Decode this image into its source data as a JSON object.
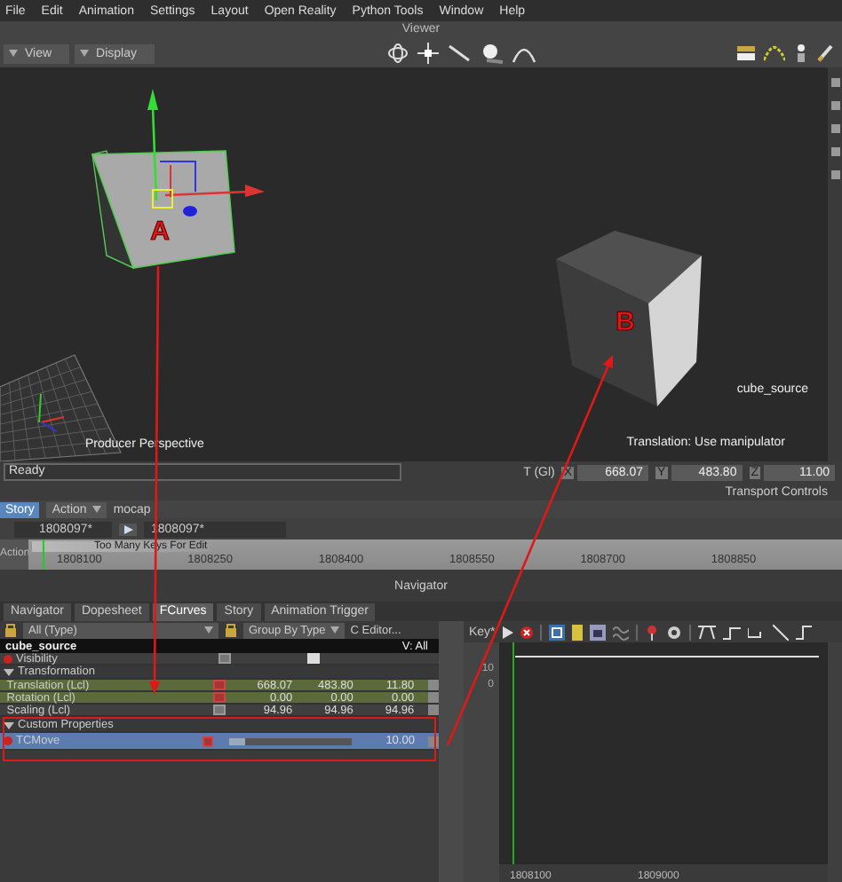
{
  "menu": [
    "File",
    "Edit",
    "Animation",
    "Settings",
    "Layout",
    "Open Reality",
    "Python Tools",
    "Window",
    "Help"
  ],
  "viewer": {
    "title": "Viewer",
    "buttons": [
      "View",
      "Display"
    ],
    "camera": "Producer Perspective",
    "object": "cube_source",
    "hint": "Translation: Use manipulator",
    "markers": [
      "A",
      "B"
    ]
  },
  "status": {
    "message": "Ready",
    "mode": "T (Gl)",
    "coords": [
      {
        "axis": "X",
        "value": "668.07"
      },
      {
        "axis": "Y",
        "value": "483.80"
      },
      {
        "axis": "Z",
        "value": "11.00"
      }
    ]
  },
  "transport": {
    "title": "Transport Controls",
    "story": "Story",
    "action": "Action",
    "take": "mocap",
    "start": "1808097*",
    "end": "1808097*",
    "track": "Action",
    "clip": "Too Many Keys For Edit",
    "ticks": [
      "1808100",
      "1808250",
      "1808400",
      "1808550",
      "1808700",
      "1808850"
    ]
  },
  "navigator": {
    "title": "Navigator",
    "tabs": [
      {
        "label": "Navigator",
        "selected": false
      },
      {
        "label": "Dopesheet",
        "selected": false
      },
      {
        "label": "FCurves",
        "selected": true
      },
      {
        "label": "Story",
        "selected": false
      },
      {
        "label": "Animation Trigger",
        "selected": false
      }
    ]
  },
  "properties": {
    "filter": "All (Type)",
    "group": "Group By Type",
    "editor": "C Editor...",
    "object": "cube_source",
    "view": "V: All",
    "rows": [
      {
        "kind": "check",
        "name": "Visibility",
        "checked": true
      },
      {
        "kind": "header",
        "name": "Transformation",
        "expanded": true
      },
      {
        "kind": "vector",
        "name": "Translation (Lcl)",
        "values": [
          "668.07",
          "483.80",
          "11.80"
        ],
        "animated": true
      },
      {
        "kind": "vector",
        "name": "Rotation (Lcl)",
        "values": [
          "0.00",
          "0.00",
          "0.00"
        ],
        "animated": true
      },
      {
        "kind": "vector",
        "name": "Scaling (Lcl)",
        "values": [
          "94.96",
          "94.96",
          "94.96"
        ],
        "animated": false
      },
      {
        "kind": "header",
        "name": "Custom Properties",
        "expanded": true
      },
      {
        "kind": "slider",
        "name": "TCMove",
        "level": 0.12,
        "value": "10.00",
        "selected": true
      }
    ]
  },
  "graph": {
    "key": "Key*",
    "y_labels": [
      "10",
      "0"
    ],
    "x_labels": [
      "1808100",
      "1809000"
    ]
  }
}
